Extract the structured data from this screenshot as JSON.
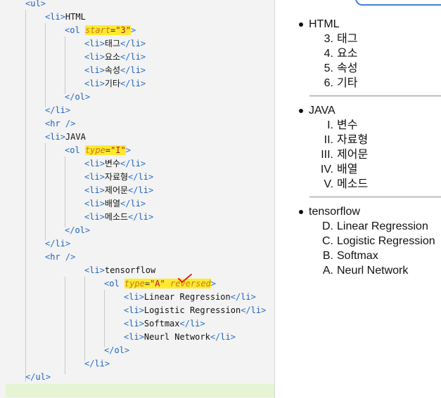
{
  "code": {
    "lines": [
      [
        "<",
        "ul",
        ">"
      ],
      [
        "<",
        "li",
        ">",
        "HTML"
      ],
      [
        "<",
        "ol",
        " ",
        "start",
        "=",
        "\"3\"",
        ">"
      ],
      [
        "<",
        "li",
        ">",
        "태그",
        "</",
        "li",
        ">"
      ],
      [
        "<",
        "li",
        ">",
        "요소",
        "</",
        "li",
        ">"
      ],
      [
        "<",
        "li",
        ">",
        "속성",
        "</",
        "li",
        ">"
      ],
      [
        "<",
        "li",
        ">",
        "기타",
        "</",
        "li",
        ">"
      ],
      [
        "</",
        "ol",
        ">"
      ],
      [
        "</",
        "li",
        ">"
      ],
      [
        "<",
        "hr",
        " />"
      ],
      [
        "<",
        "li",
        ">",
        "JAVA"
      ],
      [
        "<",
        "ol",
        " ",
        "type",
        "=",
        "\"I\"",
        ">"
      ],
      [
        "<",
        "li",
        ">",
        "변수",
        "</",
        "li",
        ">"
      ],
      [
        "<",
        "li",
        ">",
        "자료형",
        "</",
        "li",
        ">"
      ],
      [
        "<",
        "li",
        ">",
        "제어문",
        "</",
        "li",
        ">"
      ],
      [
        "<",
        "li",
        ">",
        "배열",
        "</",
        "li",
        ">"
      ],
      [
        "<",
        "li",
        ">",
        "메소드",
        "</",
        "li",
        ">"
      ],
      [
        "</",
        "ol",
        ">"
      ],
      [
        "</",
        "li",
        ">"
      ],
      [
        "<",
        "hr",
        " />"
      ],
      [
        "<",
        "li",
        ">",
        "tensorflow"
      ],
      [
        "<",
        "ol",
        " ",
        "type",
        "=",
        "\"A\"",
        " ",
        "reversed",
        ">"
      ],
      [
        "<",
        "li",
        ">",
        "Linear Regression",
        "</",
        "li",
        ">"
      ],
      [
        "<",
        "li",
        ">",
        "Logistic Regression",
        "</",
        "li",
        ">"
      ],
      [
        "<",
        "li",
        ">",
        "Softmax",
        "</",
        "li",
        ">"
      ],
      [
        "<",
        "li",
        ">",
        "Neurl Network",
        "</",
        "li",
        ">"
      ],
      [
        "</",
        "ol",
        ">"
      ],
      [
        "</",
        "li",
        ">"
      ],
      [
        "</",
        "ul",
        ">"
      ]
    ]
  },
  "preview": {
    "sections": [
      {
        "title": "HTML",
        "items": [
          {
            "marker": "3.",
            "label": "태그"
          },
          {
            "marker": "4.",
            "label": "요소"
          },
          {
            "marker": "5.",
            "label": "속성"
          },
          {
            "marker": "6.",
            "label": "기타"
          }
        ]
      },
      {
        "title": "JAVA",
        "items": [
          {
            "marker": "I.",
            "label": "변수"
          },
          {
            "marker": "II.",
            "label": "자료형"
          },
          {
            "marker": "III.",
            "label": "제어문"
          },
          {
            "marker": "IV.",
            "label": "배열"
          },
          {
            "marker": "V.",
            "label": "메소드"
          }
        ]
      },
      {
        "title": "tensorflow",
        "items": [
          {
            "marker": "D.",
            "label": "Linear Regression"
          },
          {
            "marker": "C.",
            "label": "Logistic Regression"
          },
          {
            "marker": "B.",
            "label": "Softmax"
          },
          {
            "marker": "A.",
            "label": "Neurl Network"
          }
        ]
      }
    ]
  },
  "colors": {
    "tag": "#1c5fb8",
    "attribute": "#c87a1a",
    "string": "#b5142b",
    "highlight": "#ffea2e",
    "checkmark": "#e0202a",
    "active_line": "#e5f4d3"
  },
  "icons": {
    "annotation": "red-checkmark-icon"
  }
}
